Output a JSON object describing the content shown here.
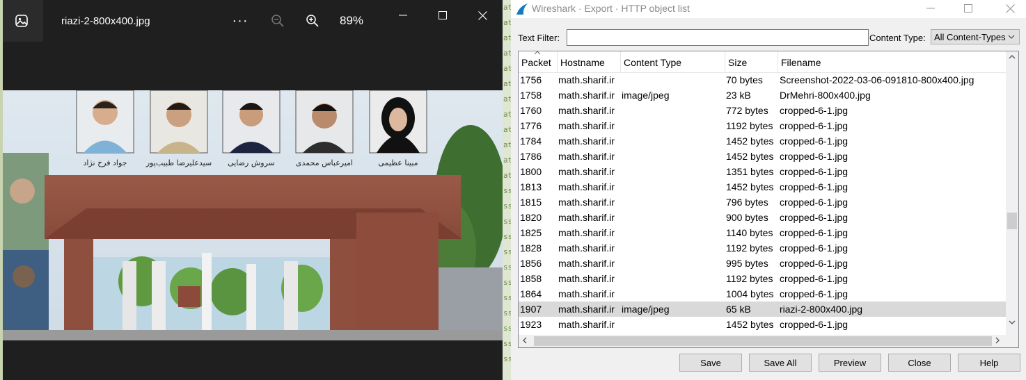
{
  "viewer": {
    "file_title": "riazi-2-800x400.jpg",
    "more_label": "···",
    "zoom_level": "89%",
    "photo": {
      "people": [
        {
          "name": "جواد فرخ نژاد"
        },
        {
          "name": "سیدعلیرضا طبیب‌پور"
        },
        {
          "name": "سروش رضایی"
        },
        {
          "name": "امیرعباس محمدی"
        },
        {
          "name": "مبینا عظیمی"
        }
      ]
    }
  },
  "background_strip": {
    "letters": [
      "at",
      "at",
      "at",
      "at",
      "at",
      "at",
      "at",
      "at",
      "at",
      "at",
      "at",
      "at",
      "ss",
      "ss",
      "ss",
      "ss",
      "ss",
      "ss",
      "ss",
      "ss",
      "ss",
      "ss",
      "ss",
      "ss"
    ]
  },
  "dialog": {
    "title": "Wireshark · Export · HTTP object list",
    "text_filter_label": "Text Filter:",
    "text_filter_value": "",
    "content_type_label": "Content Type:",
    "content_type_value": "All Content-Types",
    "columns": [
      "Packet",
      "Hostname",
      "Content Type",
      "Size",
      "Filename"
    ],
    "rows": [
      {
        "packet": "1756",
        "hostname": "math.sharif.ir",
        "content_type": "",
        "size": "70 bytes",
        "filename": "Screenshot-2022-03-06-091810-800x400.jpg"
      },
      {
        "packet": "1758",
        "hostname": "math.sharif.ir",
        "content_type": "image/jpeg",
        "size": "23 kB",
        "filename": "DrMehri-800x400.jpg"
      },
      {
        "packet": "1760",
        "hostname": "math.sharif.ir",
        "content_type": "",
        "size": "772 bytes",
        "filename": "cropped-6-1.jpg"
      },
      {
        "packet": "1776",
        "hostname": "math.sharif.ir",
        "content_type": "",
        "size": "1192 bytes",
        "filename": "cropped-6-1.jpg"
      },
      {
        "packet": "1784",
        "hostname": "math.sharif.ir",
        "content_type": "",
        "size": "1452 bytes",
        "filename": "cropped-6-1.jpg"
      },
      {
        "packet": "1786",
        "hostname": "math.sharif.ir",
        "content_type": "",
        "size": "1452 bytes",
        "filename": "cropped-6-1.jpg"
      },
      {
        "packet": "1800",
        "hostname": "math.sharif.ir",
        "content_type": "",
        "size": "1351 bytes",
        "filename": "cropped-6-1.jpg"
      },
      {
        "packet": "1813",
        "hostname": "math.sharif.ir",
        "content_type": "",
        "size": "1452 bytes",
        "filename": "cropped-6-1.jpg"
      },
      {
        "packet": "1815",
        "hostname": "math.sharif.ir",
        "content_type": "",
        "size": "796 bytes",
        "filename": "cropped-6-1.jpg"
      },
      {
        "packet": "1820",
        "hostname": "math.sharif.ir",
        "content_type": "",
        "size": "900 bytes",
        "filename": "cropped-6-1.jpg"
      },
      {
        "packet": "1825",
        "hostname": "math.sharif.ir",
        "content_type": "",
        "size": "1140 bytes",
        "filename": "cropped-6-1.jpg"
      },
      {
        "packet": "1828",
        "hostname": "math.sharif.ir",
        "content_type": "",
        "size": "1192 bytes",
        "filename": "cropped-6-1.jpg"
      },
      {
        "packet": "1856",
        "hostname": "math.sharif.ir",
        "content_type": "",
        "size": "995 bytes",
        "filename": "cropped-6-1.jpg"
      },
      {
        "packet": "1858",
        "hostname": "math.sharif.ir",
        "content_type": "",
        "size": "1192 bytes",
        "filename": "cropped-6-1.jpg"
      },
      {
        "packet": "1864",
        "hostname": "math.sharif.ir",
        "content_type": "",
        "size": "1004 bytes",
        "filename": "cropped-6-1.jpg"
      },
      {
        "packet": "1907",
        "hostname": "math.sharif.ir",
        "content_type": "image/jpeg",
        "size": "65 kB",
        "filename": "riazi-2-800x400.jpg",
        "selected": true
      },
      {
        "packet": "1923",
        "hostname": "math.sharif.ir",
        "content_type": "",
        "size": "1452 bytes",
        "filename": "cropped-6-1.jpg"
      }
    ],
    "buttons": {
      "save": "Save",
      "save_all": "Save All",
      "preview": "Preview",
      "close": "Close",
      "help": "Help"
    }
  },
  "icons": {
    "viewer_app": "photos-app-icon",
    "zoom_out": "zoom-out-icon",
    "zoom_in": "zoom-in-icon",
    "wireshark": "wireshark-fin-icon",
    "sort": "sort-ascending-icon",
    "dropdown": "chevron-down-icon"
  },
  "colors": {
    "viewer_bg": "#1f1f1f",
    "dialog_bg": "#f0f0f0",
    "selected_row": "#d9d9d9",
    "wireshark_blue": "#1679c0"
  }
}
